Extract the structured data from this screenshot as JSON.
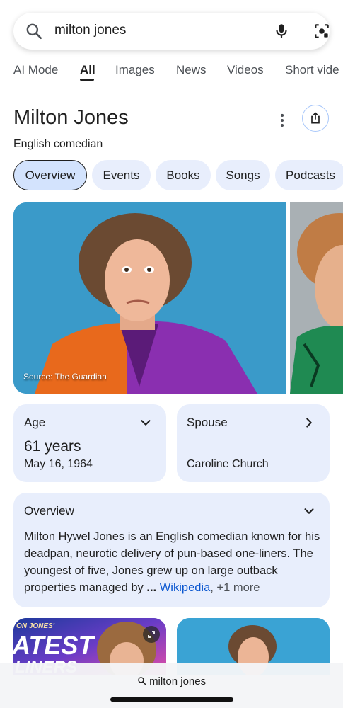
{
  "search": {
    "query": "milton jones"
  },
  "tabs": [
    {
      "label": "AI Mode"
    },
    {
      "label": "All",
      "active": true
    },
    {
      "label": "Images"
    },
    {
      "label": "News"
    },
    {
      "label": "Videos"
    },
    {
      "label": "Short vide"
    }
  ],
  "entity": {
    "title": "Milton Jones",
    "subtitle": "English comedian"
  },
  "chips": [
    {
      "label": "Overview",
      "active": true
    },
    {
      "label": "Events"
    },
    {
      "label": "Books"
    },
    {
      "label": "Songs"
    },
    {
      "label": "Podcasts"
    }
  ],
  "hero": {
    "source": "Source: The Guardian"
  },
  "age_card": {
    "label": "Age",
    "value": "61 years",
    "detail": "May 16, 1964"
  },
  "spouse_card": {
    "label": "Spouse",
    "value": "Caroline Church"
  },
  "overview_card": {
    "label": "Overview",
    "text": "Milton Hywel Jones is an English comedian known for his deadpan, neurotic delivery of pun-based one-liners. The youngest of five, Jones grew up on large outback properties managed by",
    "ellipsis": "...",
    "wiki": "Wikipedia",
    "more": ", +1 more"
  },
  "thumb1": {
    "text_top": "ON JONES'",
    "text_big": "ATEST",
    "text_bottom": "LINERS"
  },
  "bottom_bar": {
    "query": "milton jones"
  },
  "colors": {
    "accent": "#0b57d0",
    "card_bg": "#e8eefc",
    "chip_active_bg": "#d3e3fd",
    "hero_bg": "#3a9ac9"
  }
}
